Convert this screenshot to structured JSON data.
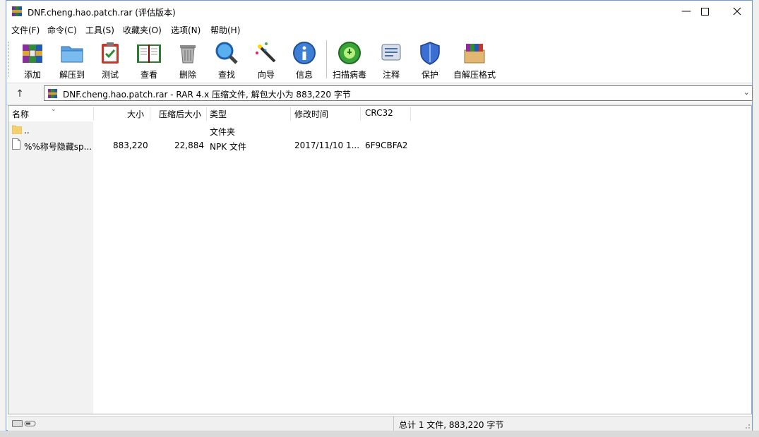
{
  "window": {
    "title": "DNF.cheng.hao.patch.rar (评估版本)",
    "controls": {
      "minimize": "—",
      "maximize": "☐",
      "close": "✕"
    }
  },
  "menu": {
    "items": [
      "文件(F)",
      "命令(C)",
      "工具(S)",
      "收藏夹(O)",
      "选项(N)",
      "帮助(H)"
    ]
  },
  "toolbar": {
    "buttons": [
      {
        "label": "添加",
        "icon": "add-archive-icon"
      },
      {
        "label": "解压到",
        "icon": "extract-folder-icon"
      },
      {
        "label": "测试",
        "icon": "test-clipboard-icon"
      },
      {
        "label": "查看",
        "icon": "view-book-icon"
      },
      {
        "label": "删除",
        "icon": "trash-bin-icon"
      },
      {
        "label": "查找",
        "icon": "magnifier-icon"
      },
      {
        "label": "向导",
        "icon": "wizard-wand-icon"
      },
      {
        "label": "信息",
        "icon": "info-icon"
      },
      {
        "label": "扫描病毒",
        "icon": "virus-scan-icon"
      },
      {
        "label": "注释",
        "icon": "comment-icon"
      },
      {
        "label": "保护",
        "icon": "shield-icon"
      },
      {
        "label": "自解压格式",
        "icon": "sfx-box-icon"
      }
    ]
  },
  "address": {
    "up_label": "↑",
    "path": "DNF.cheng.hao.patch.rar - RAR 4.x 压缩文件, 解包大小为 883,220 字节",
    "dropdown": "⌄"
  },
  "file_list": {
    "columns": [
      "名称",
      "大小",
      "压缩后大小",
      "类型",
      "修改时间",
      "CRC32"
    ],
    "rows": [
      {
        "name": "..",
        "size": "",
        "packed": "",
        "type": "文件夹",
        "modified": "",
        "crc": ""
      },
      {
        "name": "%%称号隐藏sp...",
        "size": "883,220",
        "packed": "22,884",
        "type": "NPK 文件",
        "modified": "2017/11/10 1...",
        "crc": "6F9CBFA2"
      }
    ]
  },
  "status": {
    "summary": "总计 1 文件, 883,220 字节"
  },
  "colors": {
    "accent": "#0078d7",
    "window_border": "#6b9ad6",
    "folder": "#f5d06b"
  }
}
